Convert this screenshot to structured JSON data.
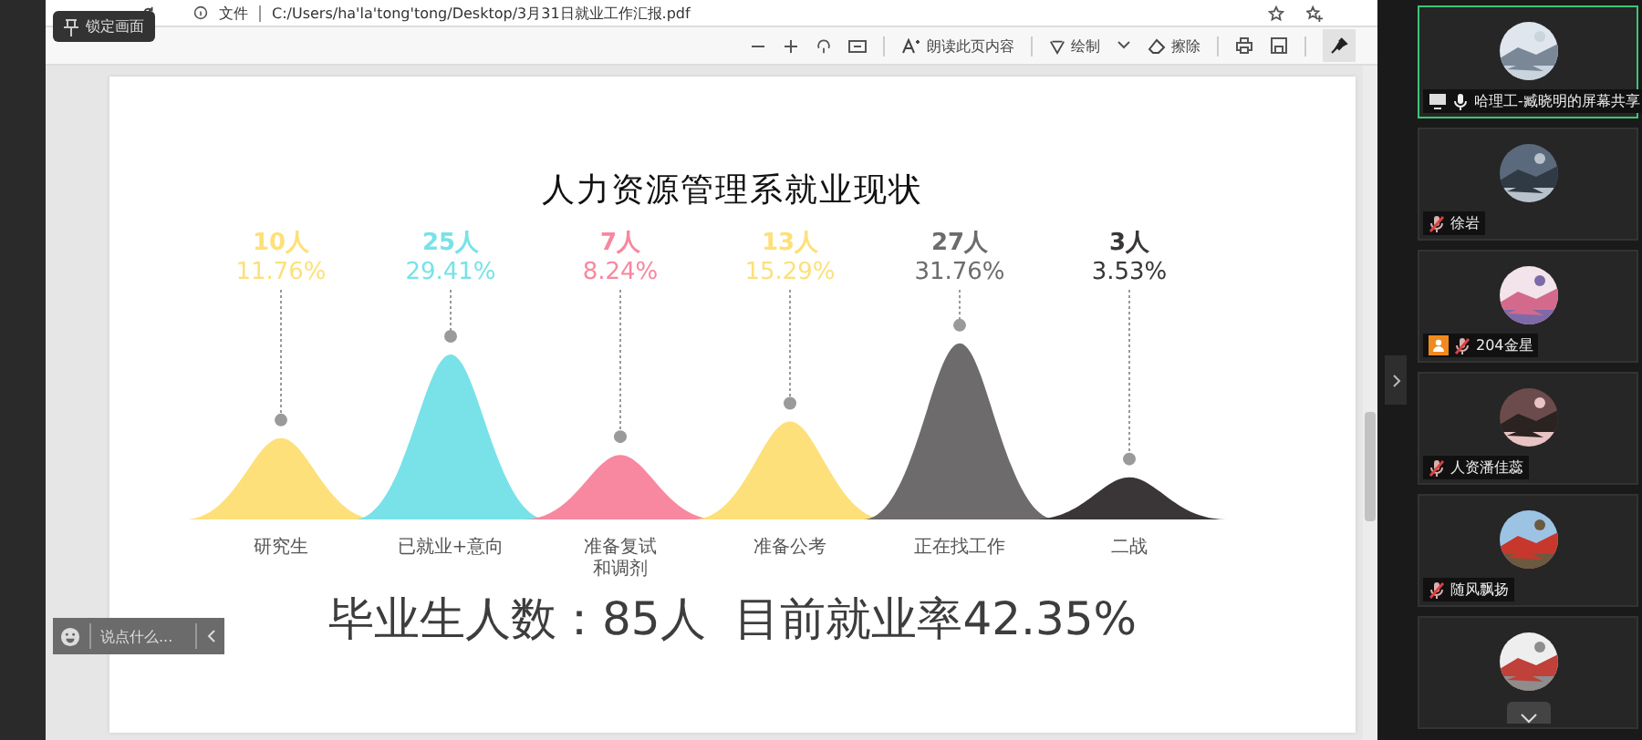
{
  "lock_tooltip": {
    "text": "锁定画面"
  },
  "address_bar": {
    "scheme": "文件",
    "url": "C:/Users/ha'la'tong'tong/Desktop/3月31日就业工作汇报.pdf"
  },
  "pdf_toolbar": {
    "read_aloud": "朗读此页内容",
    "draw": "绘制",
    "erase": "擦除",
    "pinned": true
  },
  "slide": {
    "title": "人力资源管理系就业现状",
    "groups": [
      {
        "count": "10人",
        "percent": "11.76%",
        "label_lines": [
          "研究生"
        ],
        "color": "#fde07a"
      },
      {
        "count": "25人",
        "percent": "29.41%",
        "label_lines": [
          "已就业+意向"
        ],
        "color": "#78e2e8"
      },
      {
        "count": "7人",
        "percent": "8.24%",
        "label_lines": [
          "准备复试",
          "和调剂"
        ],
        "color": "#f7889f"
      },
      {
        "count": "13人",
        "percent": "15.29%",
        "label_lines": [
          "准备公考"
        ],
        "color": "#fde07a"
      },
      {
        "count": "27人",
        "percent": "31.76%",
        "label_lines": [
          "正在找工作"
        ],
        "color": "#6d6b6c"
      },
      {
        "count": "3人",
        "percent": "3.53%",
        "label_lines": [
          "二战"
        ],
        "color": "#3a3637"
      }
    ],
    "summary": "毕业生人数：85人  目前就业率42.35%"
  },
  "chat_input": {
    "placeholder": "说点什么..."
  },
  "participants": [
    {
      "kind": "person",
      "name": "哈理工-臧晓明的屏幕共享",
      "sharing": true,
      "muted": false,
      "host": false
    },
    {
      "kind": "person",
      "name": "徐岩",
      "sharing": false,
      "muted": true,
      "host": false
    },
    {
      "kind": "person",
      "name": "204金星",
      "sharing": false,
      "muted": true,
      "host": true
    },
    {
      "kind": "person",
      "name": "人资潘佳蕊",
      "sharing": false,
      "muted": true,
      "host": false
    },
    {
      "kind": "person",
      "name": "随风飘扬",
      "sharing": false,
      "muted": true,
      "host": false
    },
    {
      "kind": "picture",
      "sharing": false
    }
  ]
}
